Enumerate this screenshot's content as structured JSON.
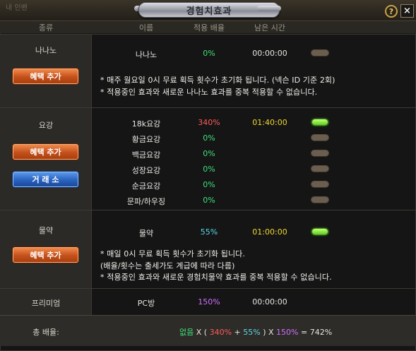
{
  "window": {
    "title": "경험치효과",
    "ghost_text": "내 인벤",
    "help": "?",
    "close": "×"
  },
  "columns": {
    "category": "종류",
    "name": "이름",
    "rate": "적용 배율",
    "time": "남은 시간"
  },
  "nanano": {
    "label": "나나노",
    "add_button": "혜택 추가",
    "item": {
      "name": "나나노",
      "rate": "0%",
      "time": "00:00:00",
      "active": false
    },
    "notes": [
      "* 매주 월요일 0시 무료 획득 횟수가 초기화 됩니다. (넥슨 ID 기준 2회)",
      "* 적용중인 효과와 새로운 나나노 효과를 중복 적용할 수 없습니다."
    ]
  },
  "yogang": {
    "label": "요강",
    "add_button": "혜택 추가",
    "exchange_button": "거 래 소",
    "items": [
      {
        "name": "18k요강",
        "rate": "340%",
        "time": "01:40:00",
        "active": true
      },
      {
        "name": "황금요강",
        "rate": "0%",
        "time": "",
        "active": false
      },
      {
        "name": "백금요강",
        "rate": "0%",
        "time": "",
        "active": false
      },
      {
        "name": "성장요강",
        "rate": "0%",
        "time": "",
        "active": false
      },
      {
        "name": "순금요강",
        "rate": "0%",
        "time": "",
        "active": false
      },
      {
        "name": "문파/하우징",
        "rate": "0%",
        "time": "",
        "active": false
      }
    ]
  },
  "potion": {
    "label": "물약",
    "add_button": "혜택 추가",
    "item": {
      "name": "물약",
      "rate": "55%",
      "time": "01:00:00",
      "active": true
    },
    "notes": [
      "* 매일 0시 무료 획득 횟수가 초기화 됩니다.",
      "(배율/횟수는 출세가도 계급에 따라 다름)",
      "* 적용중인 효과와 새로운 경험치물약 효과를 중복 적용할 수 없습니다."
    ]
  },
  "premium": {
    "label": "프리미엄",
    "name": "PC방",
    "rate": "150%",
    "time": "00:00:00"
  },
  "total": {
    "label": "총 배율:",
    "none": "없음",
    "x1": " X ( ",
    "yogang_rate": "340%",
    "plus": " + ",
    "potion_rate": "55%",
    "x2": " ) X ",
    "premium_rate": "150%",
    "result": " = 742%"
  },
  "colors": {
    "rate_zero": "#3fe07a",
    "rate_yogang": "#ff5a5a",
    "rate_potion": "#5ad8e8",
    "rate_premium": "#d070ff",
    "time_active": "#f0d830"
  }
}
